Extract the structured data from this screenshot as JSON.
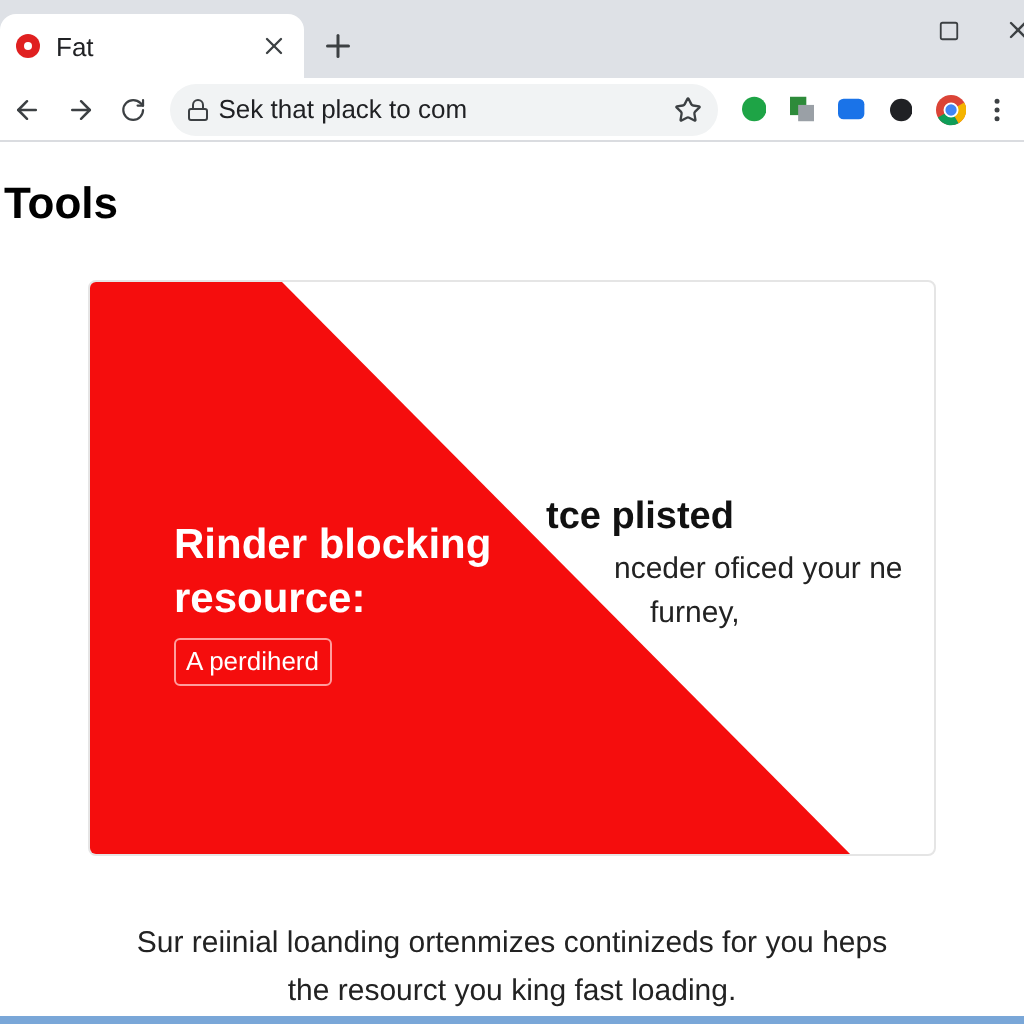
{
  "tab": {
    "title": "Fat",
    "selected": true
  },
  "address_bar": {
    "url": "Sek that plack to com"
  },
  "page": {
    "heading": "Tools",
    "card": {
      "title_partial": "tce plisted",
      "body_lines": [
        "nceder oficed your ne",
        "furney,"
      ],
      "overlay": {
        "title": "Rinder blocking resource:",
        "badge": "A perdiherd"
      }
    },
    "footer": "Sur reiinial loanding ortenmizes continizeds for you heps the resourct you king fast loading."
  }
}
